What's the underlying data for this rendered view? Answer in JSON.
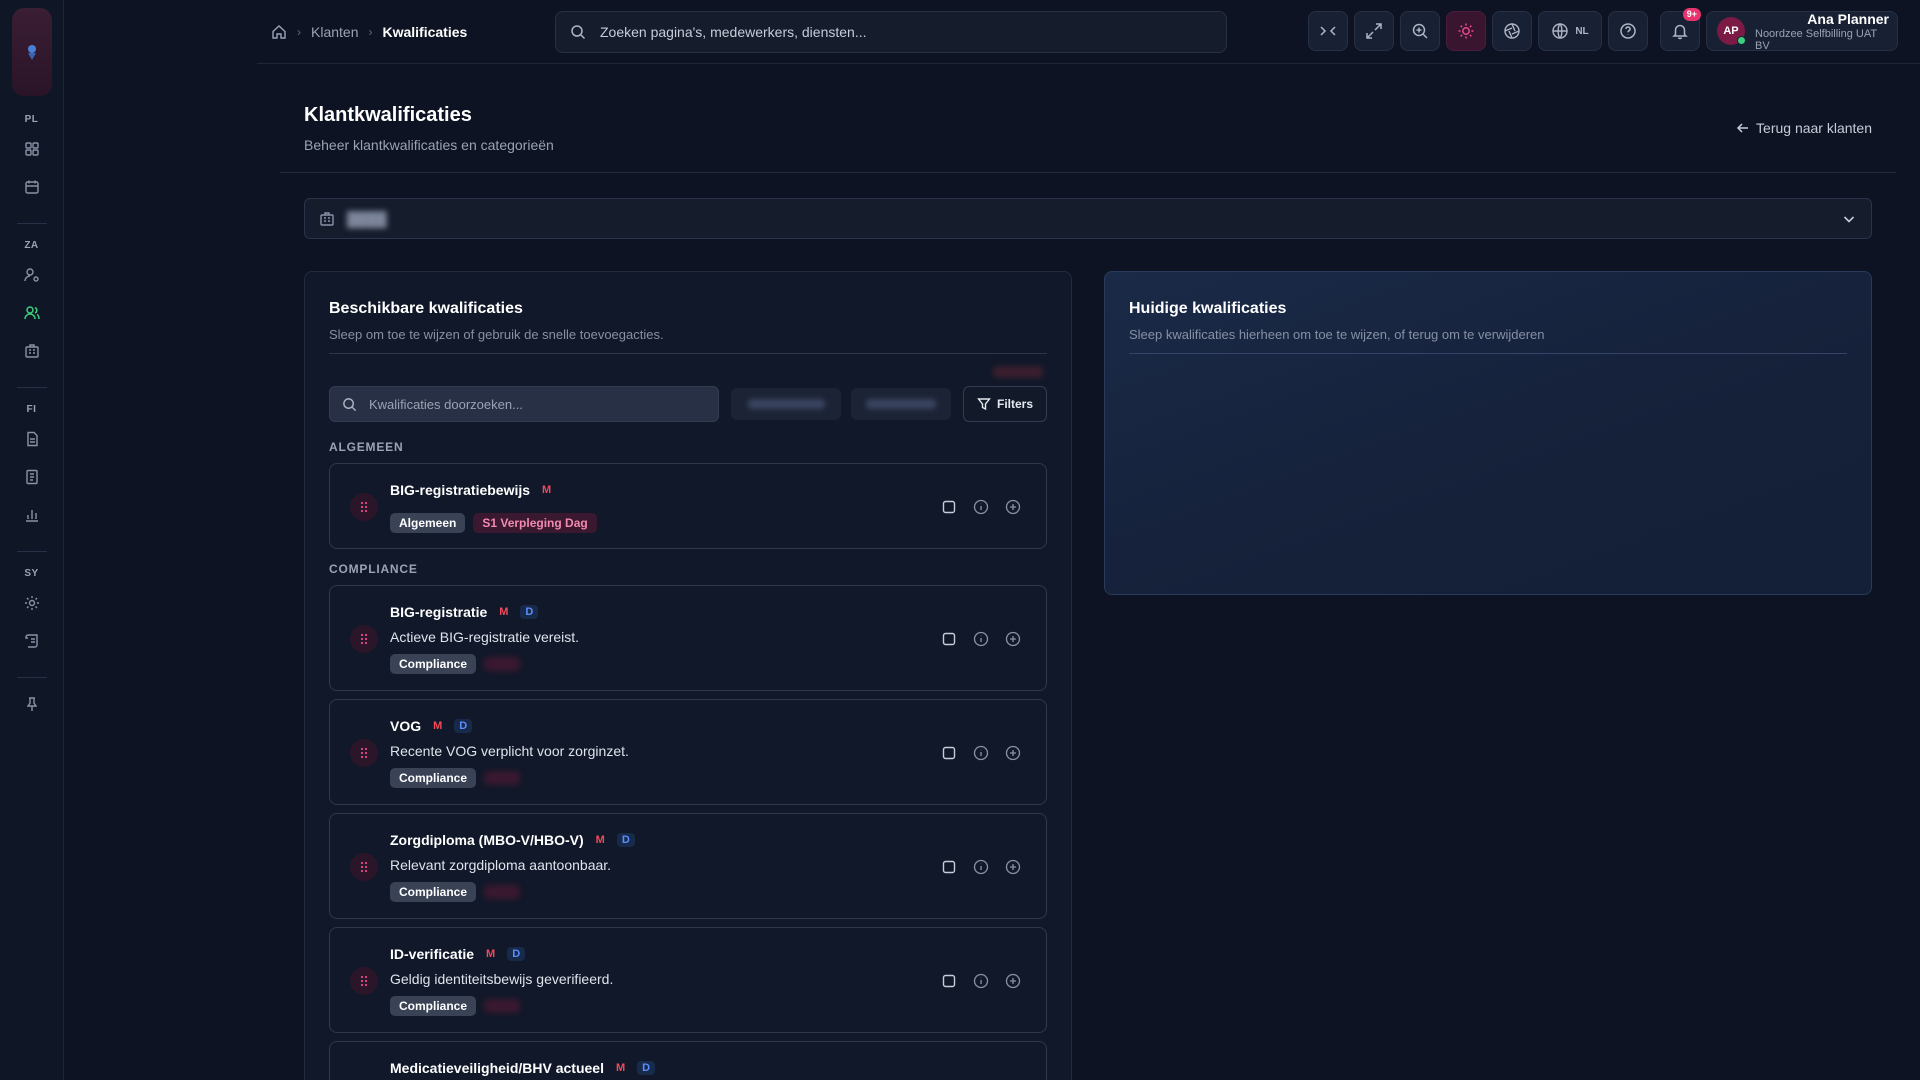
{
  "breadcrumb": {
    "items": [
      "Klanten",
      "Kwalificaties"
    ]
  },
  "search": {
    "placeholder": "Zoeken pagina's, medewerkers, diensten..."
  },
  "topbar": {
    "lang": "NL",
    "notif_badge": "9+"
  },
  "user": {
    "initials": "AP",
    "name": "Ana Planner",
    "org": "Noordzee Selfbilling UAT BV"
  },
  "rail": {
    "groups": [
      "PL",
      "ZA",
      "FI",
      "SY"
    ]
  },
  "page": {
    "title": "Klantkwalificaties",
    "subtitle": "Beheer klantkwalificaties en categorieën",
    "back": "Terug naar klanten"
  },
  "available": {
    "title": "Beschikbare kwalificaties",
    "desc": "Sleep om toe te wijzen of gebruik de snelle toevoegacties.",
    "search_placeholder": "Kwalificaties doorzoeken...",
    "filters": "Filters",
    "sections": [
      "ALGEMEEN",
      "COMPLIANCE"
    ],
    "items": [
      {
        "name": "BIG-registratiebewijs",
        "m": "M",
        "d": "",
        "desc": "",
        "chips": [
          "Algemeen",
          "S1 Verpleging Dag"
        ]
      },
      {
        "name": "BIG-registratie",
        "m": "M",
        "d": "D",
        "desc": "Actieve BIG-registratie vereist.",
        "chips": [
          "Compliance"
        ]
      },
      {
        "name": "VOG",
        "m": "M",
        "d": "D",
        "desc": "Recente VOG verplicht voor zorginzet.",
        "chips": [
          "Compliance"
        ]
      },
      {
        "name": "Zorgdiploma (MBO-V/HBO-V)",
        "m": "M",
        "d": "D",
        "desc": "Relevant zorgdiploma aantoonbaar.",
        "chips": [
          "Compliance"
        ]
      },
      {
        "name": "ID-verificatie",
        "m": "M",
        "d": "D",
        "desc": "Geldig identiteitsbewijs geverifieerd.",
        "chips": [
          "Compliance"
        ]
      },
      {
        "name": "Medicatieveiligheid/BHV actueel",
        "m": "M",
        "d": "D",
        "desc": "",
        "chips": []
      }
    ]
  },
  "current": {
    "title": "Huidige kwalificaties",
    "desc": "Sleep kwalificaties hierheen om toe te wijzen, of terug om te verwijderen"
  },
  "colors": {
    "accent": "#e84a8a",
    "active_nav": "#3ecf7d",
    "mandatory": "#f04a5c",
    "document": "#5a8dff"
  }
}
